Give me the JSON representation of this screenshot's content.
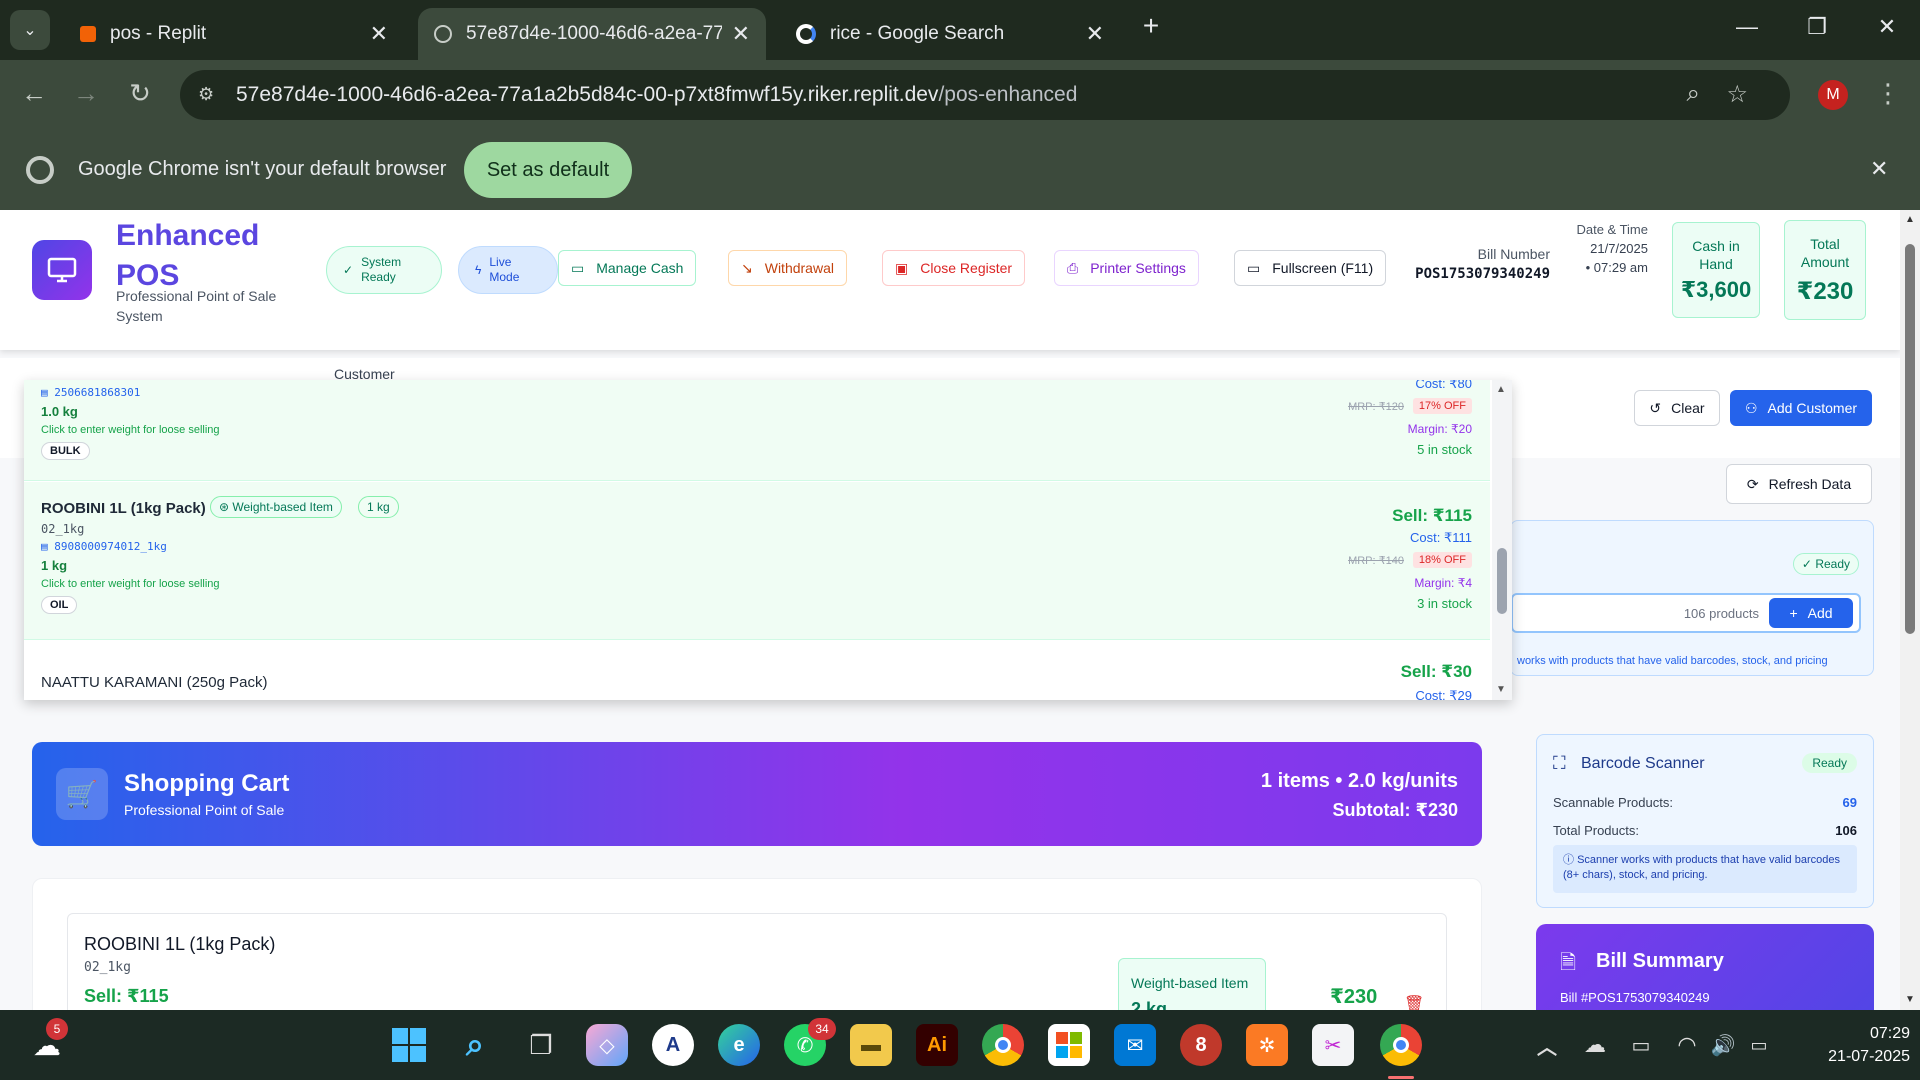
{
  "browser": {
    "tabs": [
      {
        "label": "pos - Replit"
      },
      {
        "label": "57e87d4e-1000-46d6-a2ea-77a"
      },
      {
        "label": "rice - Google Search"
      }
    ],
    "url_host": "57e87d4e-1000-46d6-a2ea-77a1a2b5d84c-00-p7xt8fmwf15y.riker.replit.dev",
    "url_path": "/pos-enhanced",
    "profile_initial": "M",
    "infobar": {
      "message": "Google Chrome isn't your default browser",
      "button": "Set as default"
    }
  },
  "header": {
    "brand_line1": "Enhanced",
    "brand_line2": "POS",
    "subtitle": "Professional Point of Sale System",
    "system_ready": "System Ready",
    "live_mode": "Live Mode",
    "manage_cash": "Manage Cash",
    "withdrawal": "Withdrawal",
    "close_register": "Close Register",
    "printer_settings": "Printer Settings",
    "fullscreen": "Fullscreen (F11)",
    "bill_number_label": "Bill Number",
    "bill_number": "POS1753079340249",
    "datetime_label": "Date & Time",
    "date": "21/7/2025",
    "time": "• 07:29 am",
    "cash_label": "Cash in Hand",
    "cash_value": "₹3,600",
    "total_label": "Total Amount",
    "total_value": "₹230"
  },
  "customer_section": {
    "customer_label": "Customer",
    "clear": "Clear",
    "add_customer": "Add Customer",
    "refresh": "Refresh Data"
  },
  "search_panel": {
    "ready": "Ready",
    "products_count": "106 products",
    "add": "Add",
    "hint": "works with products that have valid barcodes, stock, and pricing"
  },
  "dropdown": {
    "products": [
      {
        "barcode": "2506681868301",
        "weight": "1.0 kg",
        "hint": "Click to enter weight for loose selling",
        "category": "BULK",
        "cost": "Cost: ₹80",
        "mrp": "MRP: ₹120",
        "off": "17% OFF",
        "margin": "Margin: ₹20",
        "stock": "5 in stock"
      },
      {
        "name": "ROOBINI 1L (1kg Pack)",
        "weight_badge": "Weight-based Item",
        "pack_badge": "1 kg",
        "sku": "02_1kg",
        "barcode": "8908000974012_1kg",
        "weight": "1 kg",
        "hint": "Click to enter weight for loose selling",
        "category": "OIL",
        "sell": "Sell: ₹115",
        "cost": "Cost: ₹111",
        "mrp": "MRP: ₹140",
        "off": "18% OFF",
        "margin": "Margin: ₹4",
        "stock": "3 in stock"
      },
      {
        "name": "NAATTU KARAMANI (250g Pack)",
        "sell": "Sell: ₹30",
        "cost": "Cost: ₹29"
      }
    ]
  },
  "cart": {
    "title": "Shopping Cart",
    "subtitle": "Professional Point of Sale",
    "summary": "1 items • 2.0 kg/units",
    "subtotal": "Subtotal: ₹230",
    "item": {
      "name": "ROOBINI 1L (1kg Pack)",
      "sku": "02_1kg",
      "sell": "Sell: ₹115",
      "weight_label": "Weight-based Item",
      "weight_value": "2 kg",
      "total": "₹230"
    }
  },
  "scanner": {
    "title": "Barcode Scanner",
    "status": "Ready",
    "scannable_label": "Scannable Products:",
    "scannable_value": "69",
    "total_label": "Total Products:",
    "total_value": "106",
    "note": "Scanner works with products that have valid barcodes (8+ chars), stock, and pricing."
  },
  "bill_summary": {
    "title": "Bill Summary",
    "bill": "Bill #POS1753079340249"
  },
  "taskbar": {
    "weather_badge": "5",
    "whatsapp_badge": "34",
    "time": "07:29",
    "date": "21-07-2025"
  }
}
